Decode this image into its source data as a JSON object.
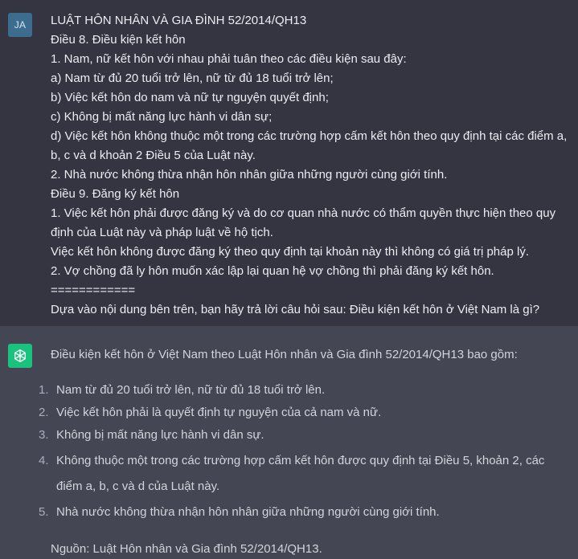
{
  "user": {
    "avatar_initials": "JA",
    "lines": [
      "LUẬT HÔN NHÂN VÀ GIA ĐÌNH 52/2014/QH13",
      "Điều 8. Điều kiện kết hôn",
      "1. Nam, nữ kết hôn với nhau phải tuân theo các điều kiện sau đây:",
      "a) Nam từ đủ 20 tuổi trở lên, nữ từ đủ 18 tuổi trở lên;",
      "b) Việc kết hôn do nam và nữ tự nguyện quyết định;",
      "c) Không bị mất năng lực hành vi dân sự;",
      "d) Việc kết hôn không thuộc một trong các trường hợp cấm kết hôn theo quy định tại các điểm a, b, c và d khoản 2 Điều 5 của Luật này.",
      "2. Nhà nước không thừa nhận hôn nhân giữa những người cùng giới tính.",
      "Điều 9. Đăng ký kết hôn",
      "1. Việc kết hôn phải được đăng ký và do cơ quan nhà nước có thẩm quyền thực hiện theo quy định của Luật này và pháp luật về hộ tịch.",
      "Việc kết hôn không được đăng ký theo quy định tại khoản này thì không có giá trị pháp lý.",
      "2. Vợ chồng đã ly hôn muốn xác lập lại quan hệ vợ chồng thì phải đăng ký kết hôn.",
      "============",
      "Dựa vào nội dung bên trên, bạn hãy trả lời câu hỏi sau: Điều kiện kết hôn ở Việt Nam là gì?"
    ]
  },
  "assistant": {
    "avatar_icon": "openai-logo-icon",
    "intro": "Điều kiện kết hôn ở Việt Nam theo Luật Hôn nhân và Gia đình 52/2014/QH13 bao gồm:",
    "items": [
      {
        "num": "1.",
        "text": "Nam từ đủ 20 tuổi trở lên, nữ từ đủ 18 tuổi trở lên."
      },
      {
        "num": "2.",
        "text": "Việc kết hôn phải là quyết định tự nguyện của cả nam và nữ."
      },
      {
        "num": "3.",
        "text": "Không bị mất năng lực hành vi dân sự."
      },
      {
        "num": "4.",
        "text": "Không thuộc một trong các trường hợp cấm kết hôn được quy định tại Điều 5, khoản 2, các điểm a, b, c và d của Luật này."
      },
      {
        "num": "5.",
        "text": "Nhà nước không thừa nhận hôn nhân giữa những người cùng giới tính."
      }
    ],
    "source": "Nguồn: Luật Hôn nhân và Gia đình 52/2014/QH13."
  },
  "colors": {
    "user_bg": "#343541",
    "assistant_bg": "#444654",
    "user_avatar": "#3c6c8e",
    "gpt_avatar": "#19c37d"
  }
}
